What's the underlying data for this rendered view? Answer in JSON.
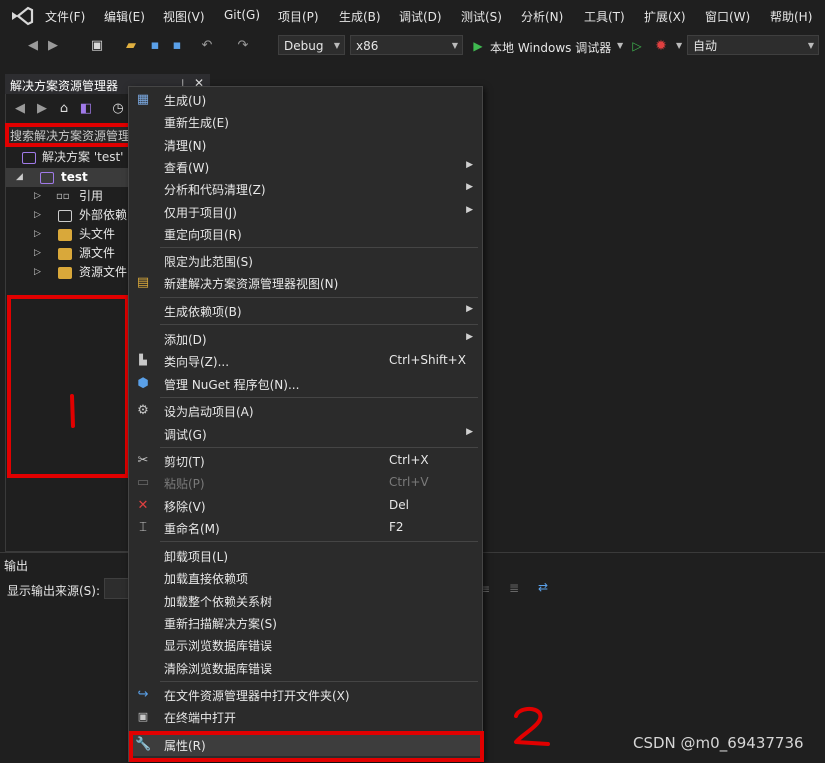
{
  "menubar": {
    "items": [
      "文件(F)",
      "编辑(E)",
      "视图(V)",
      "Git(G)",
      "项目(P)",
      "生成(B)",
      "调试(D)",
      "测试(S)",
      "分析(N)",
      "工具(T)",
      "扩展(X)",
      "窗口(W)",
      "帮助(H)"
    ]
  },
  "toolbar": {
    "config": "Debug",
    "platform": "x86",
    "run_label": "本地 Windows 调试器",
    "auto_label": "自动"
  },
  "solution_explorer": {
    "title": "解决方案资源管理器",
    "search_placeholder": "搜索解决方案资源管理",
    "solution_label": "解决方案 'test' (",
    "project": "test",
    "nodes": [
      "引用",
      "外部依赖",
      "头文件",
      "源文件",
      "资源文件"
    ]
  },
  "output": {
    "title": "输出",
    "source_label": "显示输出来源(S):"
  },
  "context_menu": {
    "items": [
      {
        "label": "生成(U)",
        "icon": "build-icon"
      },
      {
        "label": "重新生成(E)"
      },
      {
        "label": "清理(N)"
      },
      {
        "label": "查看(W)",
        "submenu": true
      },
      {
        "label": "分析和代码清理(Z)",
        "submenu": true
      },
      {
        "label": "仅用于项目(J)",
        "submenu": true
      },
      {
        "label": "重定向项目(R)"
      },
      {
        "label": "限定为此范围(S)"
      },
      {
        "label": "新建解决方案资源管理器视图(N)",
        "icon": "new-view-icon"
      },
      {
        "label": "生成依赖项(B)",
        "submenu": true
      },
      {
        "label": "添加(D)",
        "submenu": true
      },
      {
        "label": "类向导(Z)...",
        "shortcut": "Ctrl+Shift+X",
        "icon": "class-wizard-icon"
      },
      {
        "label": "管理 NuGet 程序包(N)...",
        "icon": "nuget-icon"
      },
      {
        "label": "设为启动项目(A)",
        "icon": "gear-icon"
      },
      {
        "label": "调试(G)",
        "submenu": true
      },
      {
        "label": "剪切(T)",
        "shortcut": "Ctrl+X",
        "icon": "scissors-icon"
      },
      {
        "label": "粘贴(P)",
        "shortcut": "Ctrl+V",
        "disabled": true,
        "icon": "paste-icon"
      },
      {
        "label": "移除(V)",
        "shortcut": "Del",
        "icon": "remove-icon"
      },
      {
        "label": "重命名(M)",
        "shortcut": "F2",
        "icon": "rename-icon"
      },
      {
        "label": "卸载项目(L)"
      },
      {
        "label": "加载直接依赖项"
      },
      {
        "label": "加载整个依赖关系树"
      },
      {
        "label": "重新扫描解决方案(S)"
      },
      {
        "label": "显示浏览数据库错误"
      },
      {
        "label": "清除浏览数据库错误"
      },
      {
        "label": "在文件资源管理器中打开文件夹(X)",
        "icon": "open-folder-icon"
      },
      {
        "label": "在终端中打开",
        "icon": "terminal-icon"
      },
      {
        "label": "属性(R)",
        "icon": "wrench-icon"
      }
    ]
  },
  "watermark": "CSDN @m0_69437736",
  "colors": {
    "background": "#1f1f1f",
    "menu_bg": "#2b2b2b",
    "annotation_red": "#e10000",
    "accent_purple": "#7a4fd6",
    "run_green": "#3fb950"
  }
}
